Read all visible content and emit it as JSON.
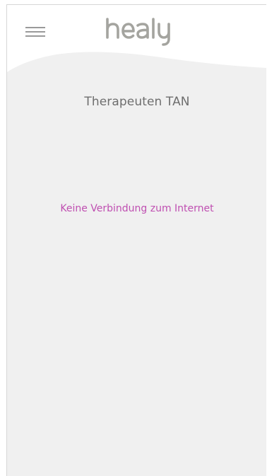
{
  "header": {
    "logo_text": "healy",
    "menu_icon": "hamburger-menu-icon"
  },
  "main": {
    "title": "Therapeuten TAN",
    "status_message": "Keine Verbindung zum Internet"
  },
  "colors": {
    "background": "#f0f0f0",
    "header": "#ffffff",
    "title": "#6e6e6e",
    "status": "#bf4fb1",
    "logo": "#a4a49f",
    "menu_icon": "#9a9a9a"
  }
}
